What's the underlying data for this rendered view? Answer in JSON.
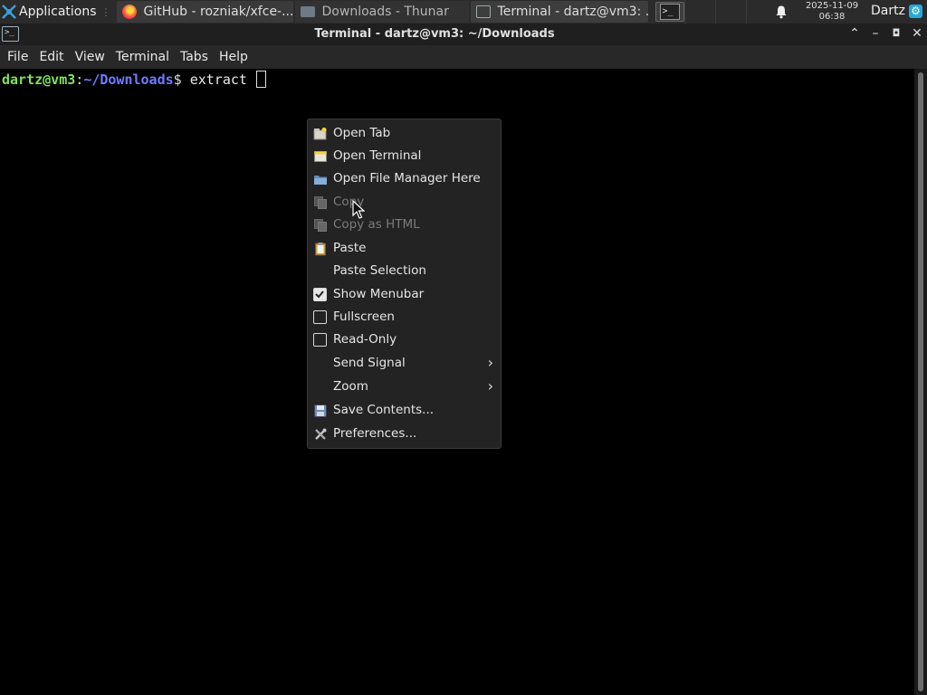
{
  "panel": {
    "applications_label": "Applications",
    "applications_separator": "⋮",
    "tasks": [
      {
        "label": "GitHub - rozniak/xfce-...",
        "icon": "firefox-icon"
      },
      {
        "label": "Downloads - Thunar",
        "icon": "folder-icon"
      },
      {
        "label": "Terminal - dartz@vm3: ...",
        "icon": "terminal-icon"
      }
    ],
    "clock": {
      "date": "2025-11-09",
      "time": "06:38"
    },
    "user": "Dartz",
    "notification_icon": "bell-icon"
  },
  "window": {
    "title": "Terminal - dartz@vm3: ~/Downloads",
    "buttons": [
      "shade",
      "minimize",
      "maximize",
      "close"
    ]
  },
  "menubar": [
    "File",
    "Edit",
    "View",
    "Terminal",
    "Tabs",
    "Help"
  ],
  "terminal": {
    "user_host": "dartz@vm3",
    "colon": ":",
    "path": "~/Downloads",
    "dollar": "$",
    "command": " extract ",
    "colors": {
      "user": "#7fe25a",
      "path": "#6f7cff"
    }
  },
  "context_menu": {
    "items": [
      {
        "label": "Open Tab",
        "icon": "new-tab-icon",
        "enabled": true
      },
      {
        "label": "Open Terminal",
        "icon": "new-window-icon",
        "enabled": true
      },
      {
        "label": "Open File Manager Here",
        "icon": "folder-icon",
        "enabled": true
      },
      {
        "label": "Copy",
        "icon": "copy-icon",
        "enabled": false
      },
      {
        "label": "Copy as HTML",
        "icon": "copy-icon",
        "enabled": false
      },
      {
        "label": "Paste",
        "icon": "paste-icon",
        "enabled": true
      },
      {
        "label": "Paste Selection",
        "icon": "",
        "enabled": true
      },
      {
        "label": "Show Menubar",
        "check": true,
        "checked": true
      },
      {
        "label": "Fullscreen",
        "check": true,
        "checked": false
      },
      {
        "label": "Read-Only",
        "check": true,
        "checked": false
      },
      {
        "label": "Send Signal",
        "submenu": true
      },
      {
        "label": "Zoom",
        "submenu": true
      },
      {
        "label": "Save Contents...",
        "icon": "save-icon",
        "enabled": true
      },
      {
        "label": "Preferences...",
        "icon": "preferences-icon",
        "enabled": true
      }
    ]
  }
}
